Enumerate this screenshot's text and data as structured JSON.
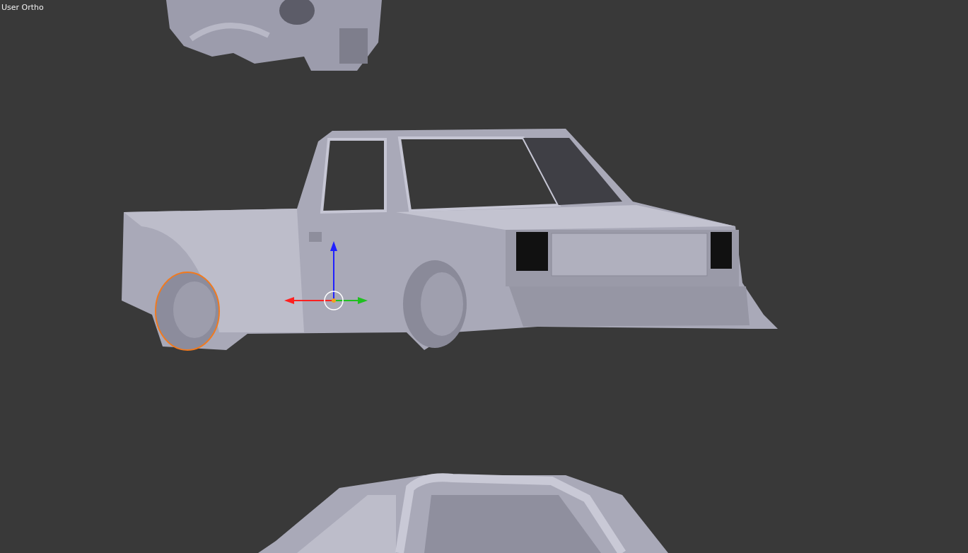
{
  "viewport": {
    "label": "User Ortho"
  }
}
